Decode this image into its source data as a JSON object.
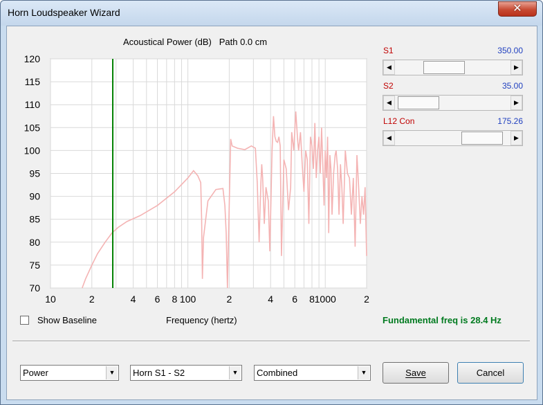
{
  "window": {
    "title": "Horn Loudspeaker Wizard",
    "close_label": "✕"
  },
  "chart": {
    "title_left": "Acoustical Power (dB)",
    "title_right": "Path 0.0 cm"
  },
  "chart_data": {
    "type": "line",
    "title": "Acoustical Power (dB)   Path 0.0 cm",
    "xlabel": "Frequency (hertz)",
    "ylabel": "",
    "x_scale": "log",
    "xlim": [
      10,
      2000
    ],
    "ylim": [
      70,
      120
    ],
    "yticks": [
      70,
      75,
      80,
      85,
      90,
      95,
      100,
      105,
      110,
      115,
      120
    ],
    "xtick_labels": [
      "10",
      "2",
      "4",
      "6",
      "8",
      "100",
      "2",
      "4",
      "6",
      "8",
      "1000",
      "2"
    ],
    "xtick_values": [
      10,
      20,
      40,
      60,
      80,
      100,
      200,
      400,
      600,
      800,
      1000,
      2000
    ],
    "grid": true,
    "marker": {
      "x": 28.4,
      "color": "#008000"
    },
    "series": [
      {
        "color": "#f4b3b3",
        "x": [
          17,
          18,
          20,
          22,
          25,
          28,
          31,
          36,
          45,
          60,
          80,
          100,
          110,
          118,
          124,
          126,
          127.5,
          130,
          140,
          160,
          180,
          186,
          190,
          194,
          200,
          205,
          210,
          230,
          260,
          290,
          310,
          320,
          330,
          335,
          340,
          345,
          350,
          360,
          370,
          385,
          395,
          410,
          420,
          430,
          440,
          450,
          460,
          470,
          480,
          500,
          520,
          540,
          560,
          570,
          590,
          610,
          630,
          640,
          660,
          680,
          700,
          720,
          740,
          760,
          780,
          800,
          820,
          840,
          860,
          880,
          900,
          920,
          940,
          960,
          980,
          1000,
          1020,
          1040,
          1060,
          1080,
          1100,
          1120,
          1150,
          1180,
          1200,
          1230,
          1260,
          1290,
          1320,
          1350,
          1400,
          1450,
          1500,
          1550,
          1600,
          1650,
          1700,
          1750,
          1800,
          1850,
          1900,
          1950,
          2000
        ],
        "values": [
          70,
          72,
          75,
          77.5,
          80,
          82,
          83.2,
          84.5,
          85.8,
          88,
          91,
          94,
          95.6,
          94.5,
          93,
          85,
          72,
          81,
          89,
          91.5,
          91.7,
          88,
          82,
          70,
          88,
          102.5,
          101,
          100.5,
          100.2,
          101,
          100.5,
          93,
          80,
          87,
          93,
          97,
          94,
          84,
          92,
          89,
          78,
          100,
          107.5,
          103,
          102,
          101.8,
          103,
          101,
          77,
          98,
          96,
          87,
          92,
          104,
          100,
          108.5,
          102,
          100,
          104,
          97,
          91,
          100,
          98,
          84,
          103,
          101,
          96,
          106,
          94,
          100,
          103,
          95,
          105,
          97,
          88,
          100,
          94,
          103,
          82,
          99,
          96,
          86,
          95,
          99,
          100,
          96,
          86,
          97,
          92,
          84,
          100,
          95,
          94,
          86,
          94,
          79,
          99,
          92,
          84,
          90,
          86,
          92,
          77
        ]
      }
    ]
  },
  "sliders": [
    {
      "label": "S1",
      "value": "350.00",
      "fraction": 0.38
    },
    {
      "label": "S2",
      "value": "35.00",
      "fraction": 0.038
    },
    {
      "label": "L12  Con",
      "value": "175.26",
      "fraction": 0.9
    }
  ],
  "options": {
    "show_baseline_label": "Show Baseline",
    "show_baseline_checked": false
  },
  "axis": {
    "frequency_label": "Frequency (hertz)"
  },
  "status": {
    "fundamental": "Fundamental freq is 28.4 Hz"
  },
  "dropdowns": {
    "mode": "Power",
    "horn": "Horn S1 - S2",
    "combine": "Combined"
  },
  "buttons": {
    "save": "Save",
    "cancel": "Cancel"
  }
}
